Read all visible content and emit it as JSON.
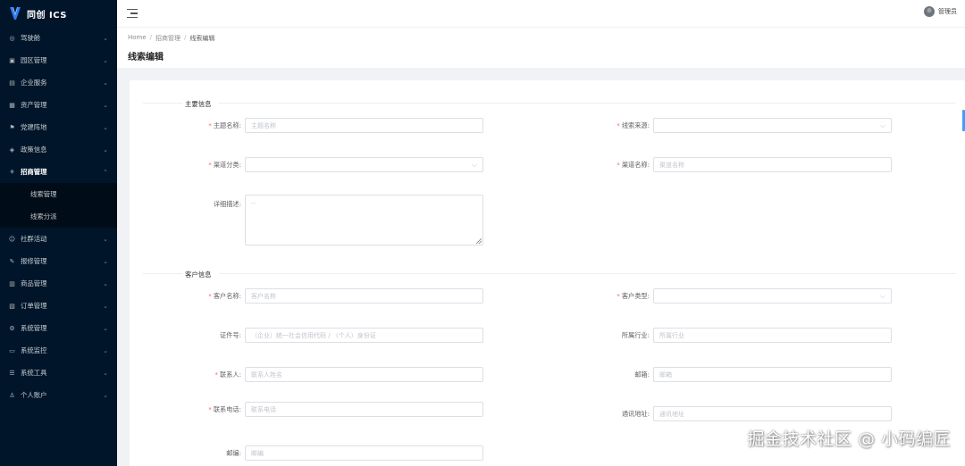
{
  "app": {
    "name": "同创 ICS"
  },
  "sidebar": {
    "items": [
      {
        "label": "驾驶舱",
        "icon": "dashboard-icon",
        "glyph": "◎"
      },
      {
        "label": "园区管理",
        "icon": "park-icon",
        "glyph": "▣"
      },
      {
        "label": "企业服务",
        "icon": "enterprise-icon",
        "glyph": "▤"
      },
      {
        "label": "资产管理",
        "icon": "asset-icon",
        "glyph": "▦"
      },
      {
        "label": "党建阵地",
        "icon": "party-icon",
        "glyph": "⚑"
      },
      {
        "label": "政策信息",
        "icon": "policy-icon",
        "glyph": "◈"
      },
      {
        "label": "招商管理",
        "icon": "investment-icon",
        "glyph": "⚘"
      },
      {
        "label": "社群活动",
        "icon": "community-icon",
        "glyph": "☺"
      },
      {
        "label": "报修管理",
        "icon": "repair-icon",
        "glyph": "✎"
      },
      {
        "label": "商品管理",
        "icon": "goods-icon",
        "glyph": "▥"
      },
      {
        "label": "订单管理",
        "icon": "order-icon",
        "glyph": "▧"
      },
      {
        "label": "系统管理",
        "icon": "system-icon",
        "glyph": "⚙"
      },
      {
        "label": "系统监控",
        "icon": "monitor-icon",
        "glyph": "▭"
      },
      {
        "label": "系统工具",
        "icon": "tools-icon",
        "glyph": "☰"
      },
      {
        "label": "个人账户",
        "icon": "user-icon",
        "glyph": "♙"
      }
    ],
    "sub_items": [
      {
        "label": "线索管理"
      },
      {
        "label": "线索分派"
      }
    ]
  },
  "header": {
    "user_name": "管理员"
  },
  "breadcrumb": {
    "home": "Home",
    "parent": "招商管理",
    "current": "线索编辑",
    "separator": "/"
  },
  "page": {
    "title": "线索编辑"
  },
  "form": {
    "section_main": "主要信息",
    "section_customer": "客户信息",
    "fields": {
      "topic_name": {
        "label": "主题名称:",
        "placeholder": "主题名称"
      },
      "lead_source": {
        "label": "线索来源:"
      },
      "channel_type": {
        "label": "渠道分类:"
      },
      "channel_name": {
        "label": "渠道名称:",
        "placeholder": "渠道名称"
      },
      "detail": {
        "label": "详细描述:",
        "placeholder": "--"
      },
      "customer_name": {
        "label": "客户名称:",
        "placeholder": "客户名称"
      },
      "customer_type": {
        "label": "客户类型:"
      },
      "certificate": {
        "label": "证件号:",
        "placeholder": "（企业）统一社会信用代码 / （个人）身份证"
      },
      "industry": {
        "label": "所属行业:",
        "placeholder": "所属行业"
      },
      "contact": {
        "label": "联系人:",
        "placeholder": "联系人姓名"
      },
      "email": {
        "label": "邮箱:",
        "placeholder": "邮箱"
      },
      "phone": {
        "label": "联系电话:",
        "placeholder": "联系电话"
      },
      "address": {
        "label": "通讯地址:",
        "placeholder": "通讯地址"
      },
      "postcode": {
        "label": "邮编:",
        "placeholder": "邮编"
      }
    }
  },
  "watermark": "掘金技术社区 @ 小码编匠",
  "colors": {
    "sidebar_bg": "#001529",
    "accent": "#409eff",
    "required": "#f56c6c"
  }
}
